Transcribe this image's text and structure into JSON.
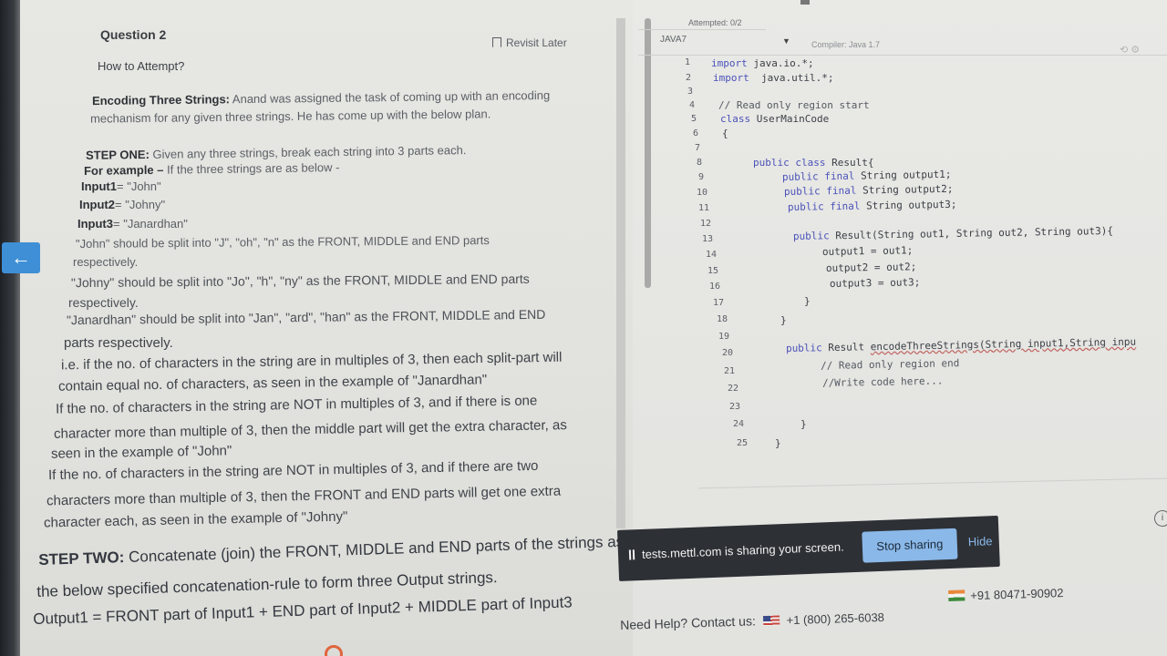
{
  "question": {
    "title": "Question 2",
    "revisit_label": "Revisit Later",
    "how_to_attempt": "How to Attempt?",
    "heading_bold": "Encoding Three Strings:",
    "heading_rest": " Anand was assigned the task of coming up with an encoding",
    "heading_line2": "mechanism for any given three strings. He has come up with the below plan.",
    "step_one_bold": "STEP ONE:",
    "step_one_rest": " Given any three strings, break each string into 3 parts each.",
    "example_bold": "For example –",
    "example_rest": " If the three strings are as below -",
    "input1_bold": "Input1",
    "input1_rest": "= \"John\"",
    "input2_bold": "Input2",
    "input2_rest": "= \"Johny\"",
    "input3_bold": "Input3",
    "input3_rest": "= \"Janardhan\"",
    "lines": [
      "\"John\" should be split into \"J\", \"oh\", \"n\" as the FRONT, MIDDLE and END parts",
      "respectively.",
      "\"Johny\" should be split into \"Jo\", \"h\", \"ny\" as the FRONT, MIDDLE and END parts",
      "respectively.",
      "\"Janardhan\" should be split into \"Jan\", \"ard\", \"han\" as the FRONT, MIDDLE and END",
      "parts respectively.",
      "i.e. if the no. of characters in the string are in multiples of 3, then each split-part will",
      "contain equal no. of characters, as seen in the example of \"Janardhan\"",
      "If the no. of characters in the string are NOT in multiples of 3, and if there is one",
      "character more than multiple of 3, then the middle part will get the extra character, as",
      "seen in the example of \"John\"",
      "If the no. of characters in the string are NOT in multiples of 3, and if there are two",
      "characters more than multiple of 3, then the FRONT and END parts will get one extra",
      "character each, as seen in the example of \"Johny\""
    ],
    "step_two_bold": "STEP TWO:",
    "step_two_rest": " Concatenate (join) the FRONT, MIDDLE and END parts of the strings as per",
    "step_two_line2": "the below specified concatenation-rule to form three Output strings.",
    "output1_line": "Output1 = FRONT part of Input1 + END part of Input2 + MIDDLE part of Input3"
  },
  "editor": {
    "attempted": "Attempted: 0/2",
    "language": "JAVA7",
    "compiler": "Compiler: Java 1.7",
    "line_numbers": [
      "1",
      "2",
      "3",
      "4",
      "5",
      "6",
      "7",
      "8",
      "9",
      "10",
      "11",
      "12",
      "13",
      "14",
      "15",
      "16",
      "17",
      "18",
      "19",
      "20",
      "21",
      "22",
      "23",
      "24",
      "25"
    ],
    "code": {
      "l1_kw": "import",
      "l1_rest": " java.io.*;",
      "l2_kw": "import",
      "l2_rest": "  java.util.*;",
      "l4": "// Read only region start",
      "l5_kw": "class",
      "l5_rest": " UserMainCode",
      "l6": "{",
      "l8_kw": "public class",
      "l8_rest": " Result{",
      "l9_kw": "public final",
      "l9_rest": " String output1;",
      "l10_kw": "public final",
      "l10_rest": " String output2;",
      "l11_kw": "public final",
      "l11_rest": " String output3;",
      "l13_kw": "public",
      "l13_rest": " Result(String out1, String out2, String out3){",
      "l14": "output1 = out1;",
      "l15": "output2 = out2;",
      "l16": "output3 = out3;",
      "l17": "}",
      "l18": "}",
      "l20_kw": "public",
      "l20_mid": " Result ",
      "l20_fn": "encodeThreeStrings(String input1,String inpu",
      "l21": "// Read only region end",
      "l22": "//Write code here...",
      "l24": "}",
      "l25": "}"
    }
  },
  "share_banner": {
    "message": "tests.mettl.com is sharing your screen.",
    "stop_label": "Stop sharing",
    "hide_label": "Hide"
  },
  "help": {
    "label": "Need Help? Contact us:",
    "phone_us": "+1 (800) 265-6038",
    "phone_in": "+91 80471-90902"
  },
  "icons": {
    "back": "arrow-left-icon",
    "revisit": "bookmark-icon",
    "dropdown": "chevron-down-icon"
  }
}
